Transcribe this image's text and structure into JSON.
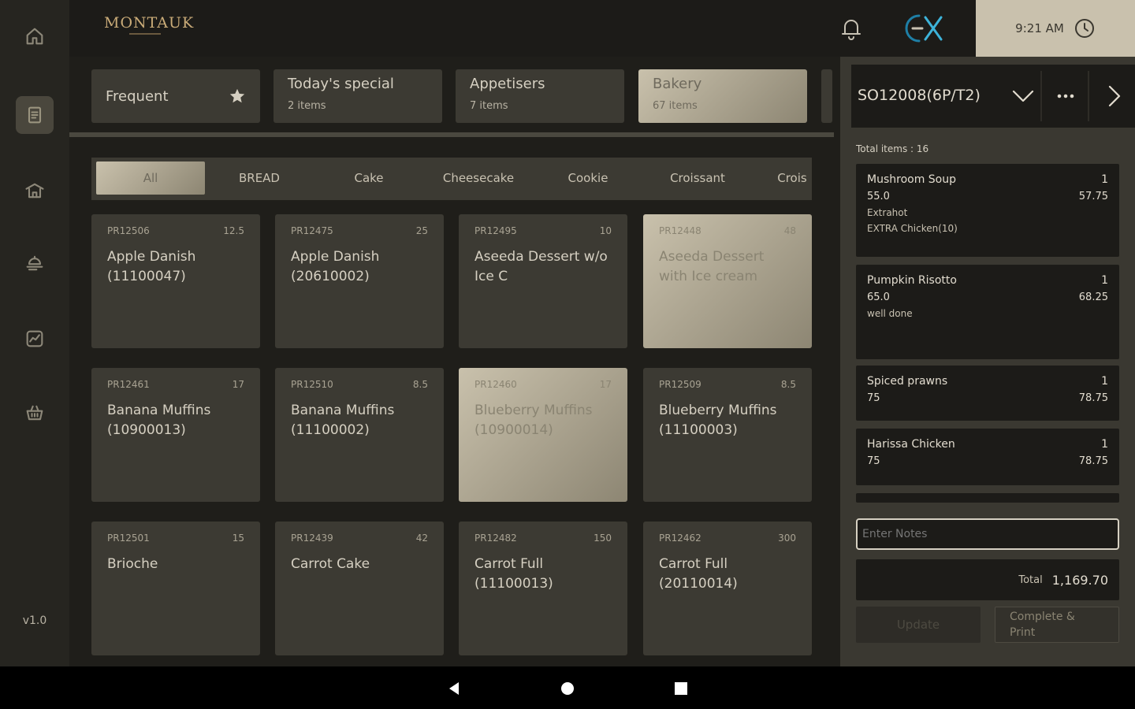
{
  "sidebar": {
    "items": [
      {
        "icon": "home-icon",
        "active": false
      },
      {
        "icon": "order-icon",
        "active": true
      },
      {
        "icon": "kitchen-icon",
        "active": false
      },
      {
        "icon": "serving-icon",
        "active": false
      },
      {
        "icon": "analytics-icon",
        "active": false
      },
      {
        "icon": "basket-icon",
        "active": false
      }
    ],
    "version": "v1.0"
  },
  "header": {
    "logo": "MONTAUK",
    "time": "9:21 AM",
    "icons": [
      "bell-icon",
      "brand-icon",
      "clock-icon"
    ]
  },
  "categories": [
    {
      "name": "Frequent",
      "count": "",
      "icon": "star-icon"
    },
    {
      "name": "Today's special",
      "count": "2 items"
    },
    {
      "name": "Appetisers",
      "count": "7 items"
    },
    {
      "name": "Bakery",
      "count": "67 items",
      "selected": true
    }
  ],
  "subcategories": [
    "All",
    "BREAD",
    "Cake",
    "Cheesecake",
    "Cookie",
    "Croissant",
    "Crois"
  ],
  "products": [
    {
      "code": "PR12506",
      "price": "12.5",
      "name1": "Apple Danish",
      "name2": "(11100047)"
    },
    {
      "code": "PR12475",
      "price": "25",
      "name1": "Apple Danish",
      "name2": "(20610002)"
    },
    {
      "code": "PR12495",
      "price": "10",
      "name1": "Aseeda Dessert w/o",
      "name2": "Ice C"
    },
    {
      "code": "PR12448",
      "price": "48",
      "name1": "Aseeda Dessert",
      "name2": "with Ice cream",
      "selected": true
    },
    {
      "code": "PR12461",
      "price": "17",
      "name1": "Banana Muffins",
      "name2": "(10900013)"
    },
    {
      "code": "PR12510",
      "price": "8.5",
      "name1": "Banana Muffins",
      "name2": "(11100002)"
    },
    {
      "code": "PR12460",
      "price": "17",
      "name1": "Blueberry Muffins",
      "name2": "(10900014)",
      "selected": true
    },
    {
      "code": "PR12509",
      "price": "8.5",
      "name1": "Blueberry Muffins",
      "name2": "(11100003)"
    },
    {
      "code": "PR12501",
      "price": "15",
      "name1": "Brioche",
      "name2": ""
    },
    {
      "code": "PR12439",
      "price": "42",
      "name1": "Carrot Cake",
      "name2": ""
    },
    {
      "code": "PR12482",
      "price": "150",
      "name1": "Carrot Full",
      "name2": "(11100013)"
    },
    {
      "code": "PR12462",
      "price": "300",
      "name1": "Carrot Full",
      "name2": "(20110014)"
    }
  ],
  "order": {
    "id": "SO12008(6P/T2)",
    "total_items": "Total items : 16",
    "items": [
      {
        "name": "Mushroom Soup",
        "qty": "1",
        "price": "55.0",
        "total": "57.75",
        "notes": [
          "Extrahot",
          "EXTRA Chicken(10)"
        ]
      },
      {
        "name": "Pumpkin Risotto",
        "qty": "1",
        "price": "65.0",
        "total": "68.25",
        "notes": [
          "well done"
        ]
      },
      {
        "name": "Spiced prawns",
        "qty": "1",
        "price": "75",
        "total": "78.75",
        "notes": []
      },
      {
        "name": "Harissa Chicken",
        "qty": "1",
        "price": "75",
        "total": "78.75",
        "notes": []
      }
    ],
    "notes_placeholder": "Enter Notes",
    "total_label": "Total",
    "total_value": "1,169.70",
    "update_label": "Update",
    "complete_label_1": "Complete &",
    "complete_label_2": "Print"
  },
  "colors": {
    "background": "#1c1b18",
    "card": "#3c3a33",
    "selected_gradient_start": "#c9c1ac",
    "selected_gradient_end": "#8d8673",
    "logo_gold": "#c9ab78"
  }
}
